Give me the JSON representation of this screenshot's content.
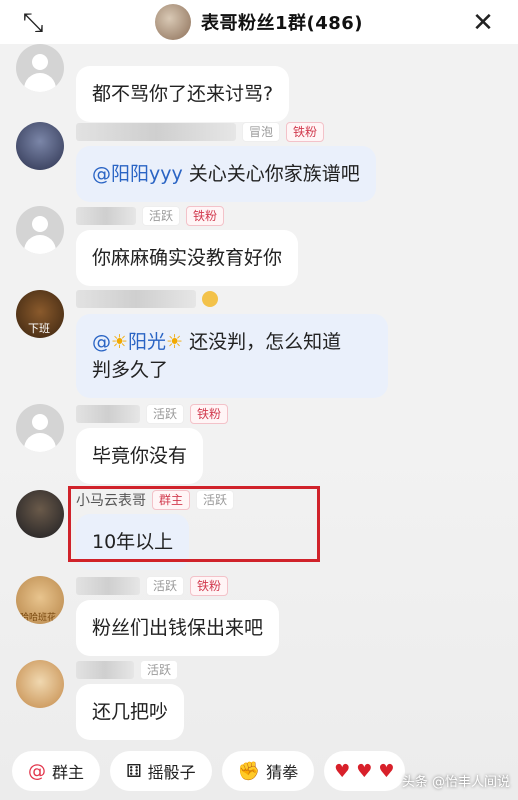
{
  "header": {
    "title": "表哥粉丝1群(486)",
    "collapse_icon": "collapse-arrows-icon",
    "close_icon": "close-icon"
  },
  "messages": [
    {
      "sender": "",
      "tags": [],
      "text": "都不骂你了还来讨骂?"
    },
    {
      "sender": "",
      "tags": [
        "冒泡",
        "铁粉"
      ],
      "mention": "@阳阳yyy",
      "text": " 关心关心你家族谱吧"
    },
    {
      "sender": "",
      "tags": [
        "活跃",
        "铁粉"
      ],
      "text": "你麻麻确实没教育好你"
    },
    {
      "sender": "",
      "tags": [],
      "mention": "@",
      "mention_name": "阳光",
      "text_line1": " 还没判，怎么知道",
      "text_line2": "判多久了"
    },
    {
      "sender": "",
      "tags": [
        "活跃",
        "铁粉"
      ],
      "text": "毕竟你没有"
    },
    {
      "sender": "小马云表哥",
      "tags": [
        "群主",
        "活跃"
      ],
      "text": "10年以上"
    },
    {
      "sender": "",
      "tags": [
        "活跃",
        "铁粉"
      ],
      "text": "粉丝们出钱保出来吧"
    },
    {
      "sender": "",
      "tags": [
        "活跃"
      ],
      "text": "还几把吵"
    }
  ],
  "avatar_labels": {
    "m4": "下班",
    "m7": "哈哈班花"
  },
  "toolbar": {
    "at_owner": "群主",
    "dice": "摇骰子",
    "rps": "猜拳"
  },
  "watermark": "头条 @怡丰人间说",
  "colors": {
    "tag_red": "#d23b4f",
    "mention_blue": "#2a64c4",
    "highlight": "#d0222a"
  }
}
